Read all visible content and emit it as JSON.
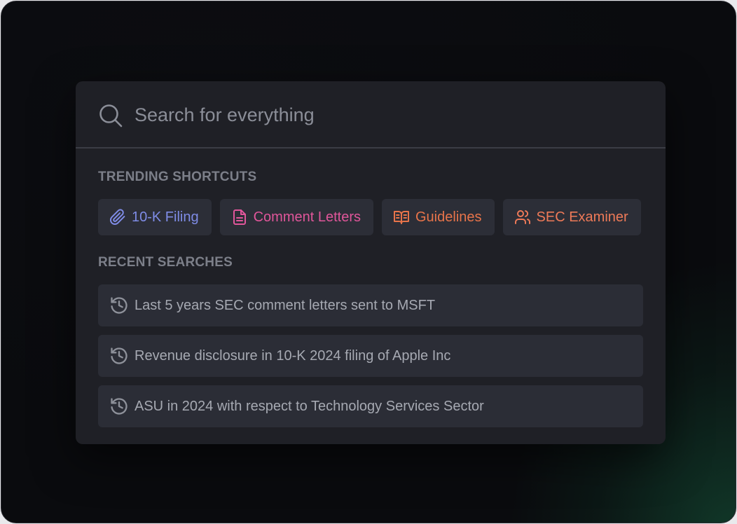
{
  "search": {
    "placeholder": "Search for everything",
    "value": ""
  },
  "trending": {
    "title": "TRENDING SHORTCUTS",
    "items": [
      {
        "label": "10-K Filing",
        "icon": "paperclip-icon",
        "color": "#7f8ce6"
      },
      {
        "label": "Comment Letters",
        "icon": "document-icon",
        "color": "#e0569a"
      },
      {
        "label": "Guidelines",
        "icon": "open-book-icon",
        "color": "#e8744a"
      },
      {
        "label": "SEC Examiner",
        "icon": "users-icon",
        "color": "#ee7a58"
      }
    ]
  },
  "recent": {
    "title": "RECENT SEARCHES",
    "icon": "history-icon",
    "items": [
      {
        "label": "Last 5 years SEC comment letters sent to MSFT"
      },
      {
        "label": "Revenue disclosure in 10-K 2024 filing of Apple Inc"
      },
      {
        "label": "ASU in 2024 with respect to Technology Services Sector"
      }
    ]
  }
}
